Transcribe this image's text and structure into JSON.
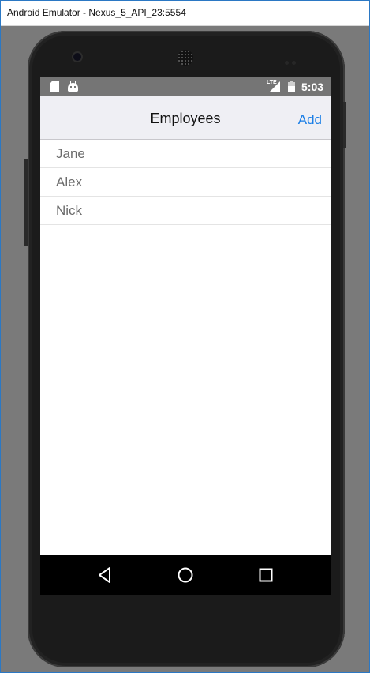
{
  "window": {
    "title": "Android Emulator - Nexus_5_API_23:5554"
  },
  "statusbar": {
    "time": "5:03",
    "network_label": "LTE",
    "icons": [
      "sd-card-icon",
      "android-icon",
      "lte-signal-icon",
      "battery-icon"
    ]
  },
  "navbar": {
    "title": "Employees",
    "add_label": "Add"
  },
  "employees": [
    {
      "name": "Jane"
    },
    {
      "name": "Alex"
    },
    {
      "name": "Nick"
    }
  ],
  "softkeys": {
    "icons": [
      "back-icon",
      "home-icon",
      "recents-icon"
    ]
  },
  "colors": {
    "accent": "#1a7ee6",
    "statusbar": "#757575",
    "navbar_bg": "#efeff4",
    "desktop_bg": "#7a7a7a"
  }
}
